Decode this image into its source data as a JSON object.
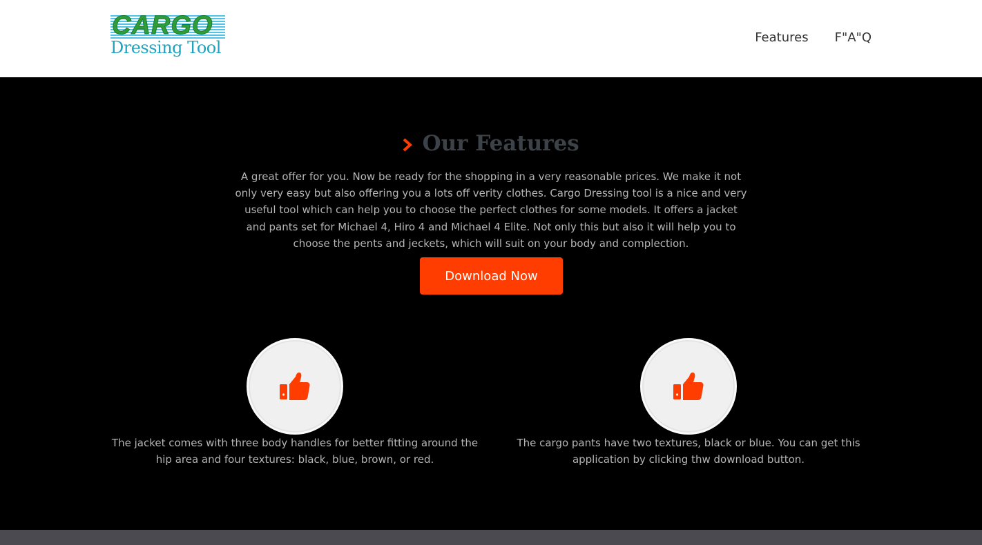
{
  "header": {
    "logo": {
      "line1": "CARGO",
      "line2": "Dressing Tool"
    },
    "nav": [
      {
        "label": "Features"
      },
      {
        "label": "F\"A\"Q"
      }
    ]
  },
  "features_section": {
    "title": "Our Features",
    "title_icon": "chevron-right-icon",
    "intro": "A great offer for you. Now be ready for the shopping in a very reasonable prices. We make it not only very easy but also offering you a lots off verity clothes. Cargo Dressing tool is a nice and very useful tool which can help you to choose the perfect clothes for some models. It offers a jacket and pants set for Michael 4, Hiro 4 and Michael 4 Elite. Not only this but also it will help you to choose the pents and jeckets, which will suit on your body and complection.",
    "download_button": "Download Now",
    "items": [
      {
        "icon": "thumbs-up-icon",
        "text": "The jacket comes with three body handles for better fitting around the hip area and four textures: black, blue, brown, or red."
      },
      {
        "icon": "thumbs-up-icon",
        "text": "The cargo pants have two textures, black or blue. You can get this application by clicking thw download button."
      }
    ]
  },
  "colors": {
    "accent": "#ff3d00",
    "background": "#000000",
    "header_background": "#ffffff",
    "footer_bar": "#4a4a50"
  }
}
